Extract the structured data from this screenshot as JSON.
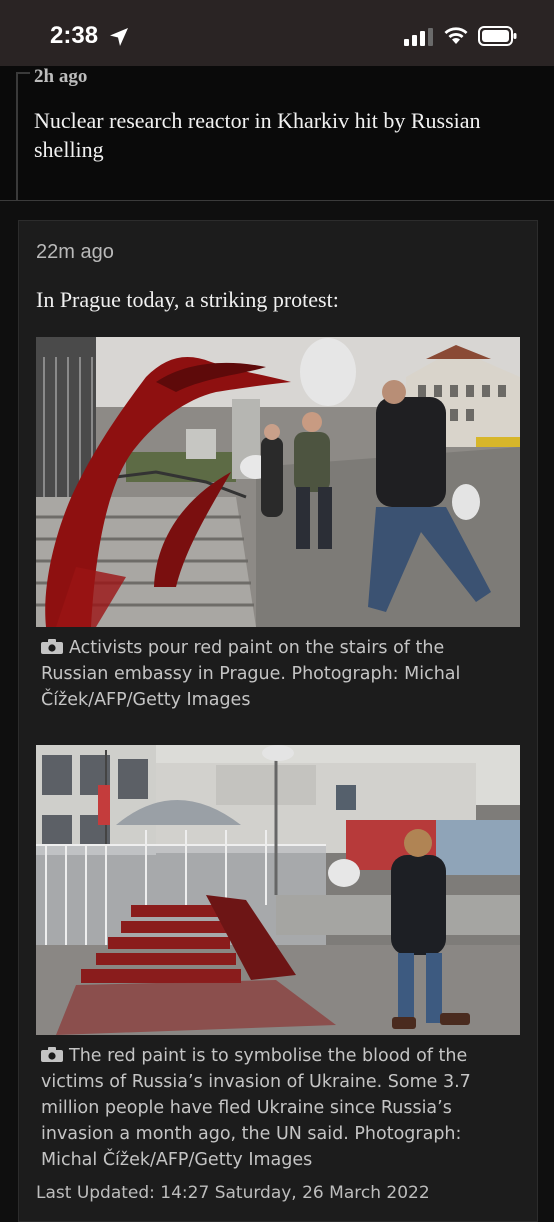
{
  "status_bar": {
    "time": "2:38",
    "icons": [
      "location-arrow-icon",
      "cellular-signal-icon",
      "wifi-icon",
      "battery-icon"
    ]
  },
  "previous_entry": {
    "timestamp": "2h ago",
    "title": "Nuclear research reactor in Kharkiv hit by Russian shelling"
  },
  "entry": {
    "timestamp": "22m ago",
    "headline": "In Prague today, a striking protest:",
    "photos": [
      {
        "caption": "Activists pour red paint on the stairs of the Russian embassy in Prague. Photograph: Michal Čížek/AFP/Getty Images"
      },
      {
        "caption": "The red paint is to symbolise the blood of the victims of Russia’s invasion of Ukraine. Some 3.7 million people have fled Ukraine since Russia’s invasion a month ago, the UN said. Photograph: Michal Čížek/AFP/Getty Images"
      }
    ],
    "last_updated": "Last Updated: 14:27 Saturday, 26 March 2022"
  },
  "colors": {
    "background": "#0f0f0f",
    "card": "#1c1c1c",
    "text": "#f0f0f0",
    "muted": "#b9b9b9",
    "paint_red": "#8e1010"
  }
}
